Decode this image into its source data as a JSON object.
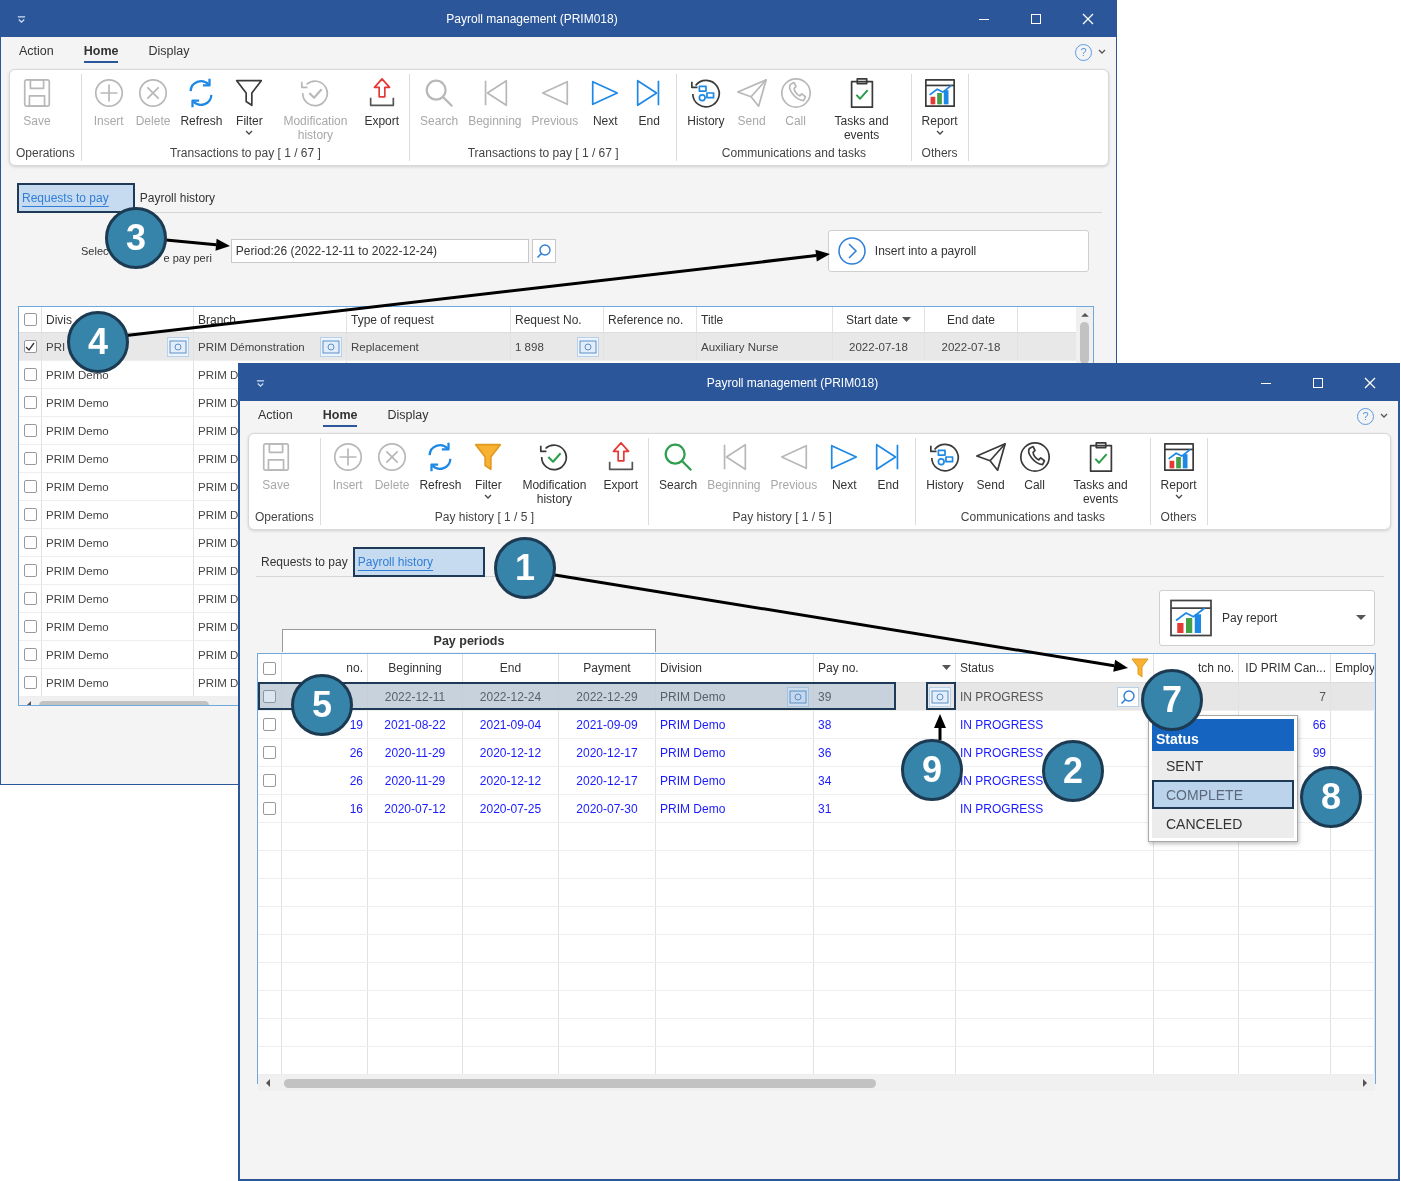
{
  "back_window": {
    "title": "Payroll management (PRIM018)",
    "help": "?",
    "menu": [
      {
        "label": "Action",
        "selected": false
      },
      {
        "label": "Home",
        "selected": true
      },
      {
        "label": "Display",
        "selected": false
      }
    ],
    "ribbon": [
      {
        "caption": "Operations",
        "buttons": [
          {
            "kind": "save",
            "label": "Save",
            "enabled": false,
            "dropdown": false
          }
        ]
      },
      {
        "caption": "Transactions to pay [ 1 / 67 ]",
        "buttons": [
          {
            "kind": "insert",
            "label": "Insert",
            "enabled": false,
            "dropdown": false
          },
          {
            "kind": "delete",
            "label": "Delete",
            "enabled": false,
            "dropdown": false
          },
          {
            "kind": "refresh",
            "label": "Refresh",
            "enabled": true,
            "dropdown": false
          },
          {
            "kind": "filter",
            "label": "Filter",
            "enabled": true,
            "dropdown": true,
            "active": false
          },
          {
            "kind": "modification",
            "label": "Modification history",
            "enabled": false,
            "dropdown": false
          },
          {
            "kind": "export",
            "label": "Export",
            "enabled": true,
            "dropdown": false
          }
        ]
      },
      {
        "caption": "Transactions to pay [ 1 / 67 ]",
        "buttons": [
          {
            "kind": "search",
            "label": "Search",
            "enabled": false,
            "dropdown": false
          },
          {
            "kind": "beginning",
            "label": "Beginning",
            "enabled": false,
            "dropdown": false
          },
          {
            "kind": "previous",
            "label": "Previous",
            "enabled": false,
            "dropdown": false
          },
          {
            "kind": "next",
            "label": "Next",
            "enabled": true,
            "dropdown": false
          },
          {
            "kind": "end",
            "label": "End",
            "enabled": true,
            "dropdown": false
          }
        ]
      },
      {
        "caption": "Communications and tasks",
        "buttons": [
          {
            "kind": "history",
            "label": "History",
            "enabled": true,
            "dropdown": false
          },
          {
            "kind": "send",
            "label": "Send",
            "enabled": false,
            "dropdown": false
          },
          {
            "kind": "call",
            "label": "Call",
            "enabled": false,
            "dropdown": false
          },
          {
            "kind": "tasks",
            "label": "Tasks and events",
            "enabled": true,
            "dropdown": false
          }
        ]
      },
      {
        "caption": "Others",
        "buttons": [
          {
            "kind": "report",
            "label": "Report",
            "enabled": true,
            "dropdown": true
          }
        ]
      }
    ],
    "tabs": [
      {
        "label": "Requests to pay",
        "selected": true
      },
      {
        "label": "Payroll history",
        "selected": false
      }
    ],
    "period_label_parts": [
      "Selec",
      "e pay peri"
    ],
    "period_field": {
      "value": "Period:26 (2022-12-11 to 2022-12-24)"
    },
    "insert_button": "Insert into a payroll",
    "table": {
      "select_all_checked": false,
      "columns": [
        {
          "label": "Divis",
          "kind": "text"
        },
        {
          "label": "Branch",
          "kind": "text"
        },
        {
          "label": "Type of request",
          "kind": "text"
        },
        {
          "label": "Request No.",
          "kind": "text"
        },
        {
          "label": "Reference no.",
          "kind": "text"
        },
        {
          "label": "Title",
          "kind": "text"
        },
        {
          "label": "Start date",
          "kind": "date"
        },
        {
          "label": "End date",
          "kind": "date"
        }
      ],
      "rows": [
        {
          "checked": true,
          "selected": true,
          "cells": [
            {
              "text": "PRI"
            },
            {
              "text": "PRIM Démonstration"
            },
            {
              "text": "Replacement"
            },
            {
              "text": "1 898"
            },
            {},
            {
              "text": "Auxiliary Nurse"
            },
            {
              "text": "2022-07-18"
            },
            {
              "text": "2022-07-18"
            }
          ]
        },
        {
          "checked": false,
          "selected": false,
          "cells": [
            {
              "text": "PRIM Demo"
            },
            {
              "text": "PRIM D"
            }
          ]
        },
        {
          "checked": false,
          "selected": false,
          "cells": [
            {
              "text": "PRIM Demo"
            },
            {
              "text": "PRIM D"
            }
          ]
        },
        {
          "checked": false,
          "selected": false,
          "cells": [
            {
              "text": "PRIM Demo"
            },
            {
              "text": "PRIM D"
            }
          ]
        },
        {
          "checked": false,
          "selected": false,
          "cells": [
            {
              "text": "PRIM Demo"
            },
            {
              "text": "PRIM D"
            }
          ]
        },
        {
          "checked": false,
          "selected": false,
          "cells": [
            {
              "text": "PRIM Demo"
            },
            {
              "text": "PRIM D"
            }
          ]
        },
        {
          "checked": false,
          "selected": false,
          "cells": [
            {
              "text": "PRIM Demo"
            },
            {
              "text": "PRIM D"
            }
          ]
        },
        {
          "checked": false,
          "selected": false,
          "cells": [
            {
              "text": "PRIM Demo"
            },
            {
              "text": "PRIM D"
            }
          ]
        },
        {
          "checked": false,
          "selected": false,
          "cells": [
            {
              "text": "PRIM Demo"
            },
            {
              "text": "PRIM D"
            }
          ]
        },
        {
          "checked": false,
          "selected": false,
          "cells": [
            {
              "text": "PRIM Demo"
            },
            {
              "text": "PRIM D"
            }
          ]
        },
        {
          "checked": false,
          "selected": false,
          "cells": [
            {
              "text": "PRIM Demo"
            },
            {
              "text": "PRIM D"
            }
          ]
        },
        {
          "checked": false,
          "selected": false,
          "cells": [
            {
              "text": "PRIM Demo"
            },
            {
              "text": "PRIM D"
            }
          ]
        },
        {
          "checked": false,
          "selected": false,
          "cells": [
            {
              "text": "PRIM Demo"
            },
            {
              "text": "PRIM D"
            }
          ]
        }
      ]
    }
  },
  "front_window": {
    "title": "Payroll management (PRIM018)",
    "help": "?",
    "menu": [
      {
        "label": "Action",
        "selected": false
      },
      {
        "label": "Home",
        "selected": true
      },
      {
        "label": "Display",
        "selected": false
      }
    ],
    "ribbon": [
      {
        "caption": "Operations",
        "buttons": [
          {
            "kind": "save",
            "label": "Save",
            "enabled": false,
            "dropdown": false
          }
        ]
      },
      {
        "caption": "Pay history [ 1 / 5 ]",
        "buttons": [
          {
            "kind": "insert",
            "label": "Insert",
            "enabled": false,
            "dropdown": false
          },
          {
            "kind": "delete",
            "label": "Delete",
            "enabled": false,
            "dropdown": false
          },
          {
            "kind": "refresh",
            "label": "Refresh",
            "enabled": true,
            "dropdown": false
          },
          {
            "kind": "filter",
            "label": "Filter",
            "enabled": true,
            "dropdown": true,
            "active": true
          },
          {
            "kind": "modification",
            "label": "Modification history",
            "enabled": true,
            "dropdown": false
          },
          {
            "kind": "export",
            "label": "Export",
            "enabled": true,
            "dropdown": false
          }
        ]
      },
      {
        "caption": "Pay history [ 1 / 5 ]",
        "buttons": [
          {
            "kind": "search",
            "label": "Search",
            "enabled": true,
            "dropdown": false
          },
          {
            "kind": "beginning",
            "label": "Beginning",
            "enabled": false,
            "dropdown": false
          },
          {
            "kind": "previous",
            "label": "Previous",
            "enabled": false,
            "dropdown": false
          },
          {
            "kind": "next",
            "label": "Next",
            "enabled": true,
            "dropdown": false
          },
          {
            "kind": "end",
            "label": "End",
            "enabled": true,
            "dropdown": false
          }
        ]
      },
      {
        "caption": "Communications and tasks",
        "buttons": [
          {
            "kind": "history",
            "label": "History",
            "enabled": true,
            "dropdown": false
          },
          {
            "kind": "send",
            "label": "Send",
            "enabled": true,
            "dropdown": false
          },
          {
            "kind": "call",
            "label": "Call",
            "enabled": true,
            "dropdown": false
          },
          {
            "kind": "tasks",
            "label": "Tasks and events",
            "enabled": true,
            "dropdown": false
          }
        ]
      },
      {
        "caption": "Others",
        "buttons": [
          {
            "kind": "report",
            "label": "Report",
            "enabled": true,
            "dropdown": true
          }
        ]
      }
    ],
    "tabs": [
      {
        "label": "Requests to pay",
        "selected": false
      },
      {
        "label": "Payroll history",
        "selected": true
      }
    ],
    "pay_report_button": "Pay report",
    "group_header": "Pay periods",
    "table": {
      "select_all_checked": false,
      "columns": [
        {
          "label": "no.",
          "kind": "number"
        },
        {
          "label": "Beginning",
          "kind": "date"
        },
        {
          "label": "End",
          "kind": "date"
        },
        {
          "label": "Payment",
          "kind": "date"
        },
        {
          "label": "Division",
          "kind": "text"
        },
        {
          "label": "Pay no.",
          "kind": "text"
        },
        {
          "label": "Status",
          "kind": "text"
        },
        {
          "label": "tch no.",
          "kind": "number"
        },
        {
          "label": "ID PRIM Can...",
          "kind": "number"
        },
        {
          "label": "Employ",
          "kind": "text"
        }
      ],
      "rows": [
        {
          "checked": false,
          "selected": true,
          "cells": [
            {},
            {
              "text": "2022-12-11"
            },
            {
              "text": "2022-12-24"
            },
            {
              "text": "2022-12-29"
            },
            {
              "text": "PRIM Demo"
            },
            {
              "text": "39"
            },
            {
              "text": "IN PROGRESS"
            },
            {},
            {
              "text": "7"
            },
            {}
          ]
        },
        {
          "checked": false,
          "selected": false,
          "cells": [
            {
              "text": "19"
            },
            {
              "text": "2021-08-22"
            },
            {
              "text": "2021-09-04"
            },
            {
              "text": "2021-09-09"
            },
            {
              "text": "PRIM Demo"
            },
            {
              "text": "38"
            },
            {
              "text": "IN PROGRESS"
            },
            {},
            {
              "text": "66"
            },
            {}
          ]
        },
        {
          "checked": false,
          "selected": false,
          "cells": [
            {
              "text": "26"
            },
            {
              "text": "2020-11-29"
            },
            {
              "text": "2020-12-12"
            },
            {
              "text": "2020-12-17"
            },
            {
              "text": "PRIM Demo"
            },
            {
              "text": "36"
            },
            {
              "text": "IN PROGRESS"
            },
            {},
            {
              "text": "99"
            },
            {}
          ]
        },
        {
          "checked": false,
          "selected": false,
          "cells": [
            {
              "text": "26"
            },
            {
              "text": "2020-11-29"
            },
            {
              "text": "2020-12-12"
            },
            {
              "text": "2020-12-17"
            },
            {
              "text": "PRIM Demo"
            },
            {
              "text": "34"
            },
            {
              "text": "IN PROGRESS"
            },
            {},
            {},
            {}
          ]
        },
        {
          "checked": false,
          "selected": false,
          "cells": [
            {
              "text": "16"
            },
            {
              "text": "2020-07-12"
            },
            {
              "text": "2020-07-25"
            },
            {
              "text": "2020-07-30"
            },
            {
              "text": "PRIM Demo"
            },
            {
              "text": "31"
            },
            {
              "text": "IN PROGRESS"
            },
            {},
            {},
            {}
          ]
        }
      ]
    },
    "status_menu": {
      "header": "Status",
      "items": [
        {
          "label": "SENT",
          "selected": false
        },
        {
          "label": "COMPLETE",
          "selected": true
        },
        {
          "label": "CANCELED",
          "selected": false
        }
      ]
    }
  },
  "callouts": [
    {
      "number": "3"
    },
    {
      "number": "4"
    },
    {
      "number": "1"
    },
    {
      "number": "5"
    },
    {
      "number": "7"
    },
    {
      "number": "9"
    },
    {
      "number": "2"
    },
    {
      "number": "8"
    }
  ]
}
